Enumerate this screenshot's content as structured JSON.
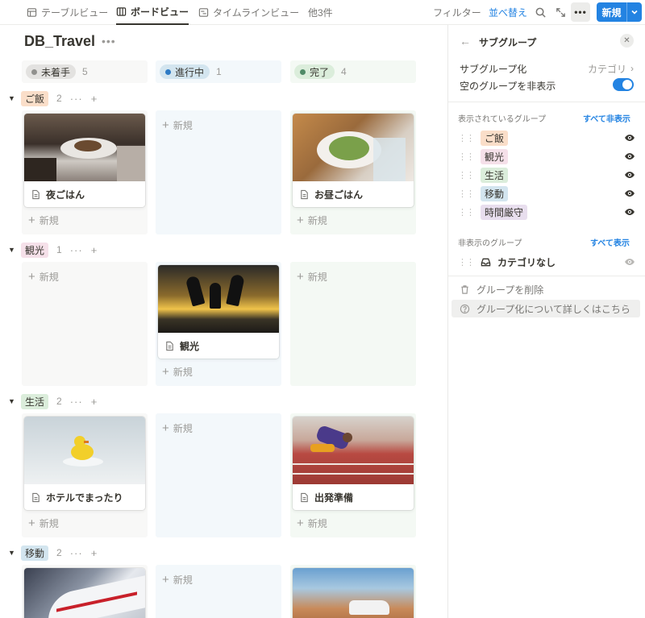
{
  "tabs": [
    {
      "label": "テーブルビュー",
      "icon": "table-icon",
      "active": false
    },
    {
      "label": "ボードビュー",
      "icon": "board-icon",
      "active": true
    },
    {
      "label": "タイムラインビュー",
      "icon": "timeline-icon",
      "active": false
    },
    {
      "label": "他3件",
      "icon": "",
      "active": false
    }
  ],
  "toolbar": {
    "filter_label": "フィルター",
    "sort_label": "並べ替え",
    "more_label": "•••",
    "new_label": "新規"
  },
  "board": {
    "title": "DB_Travel",
    "title_more": "•••",
    "columns": [
      {
        "label": "未着手",
        "count": "5",
        "dot": "#91918e",
        "pill": "#e3e2e0",
        "bg": "#f8f8f7"
      },
      {
        "label": "進行中",
        "count": "1",
        "dot": "#2e7bc5",
        "pill": "#d3e5ef",
        "bg": "#f3f8fb"
      },
      {
        "label": "完了",
        "count": "4",
        "dot": "#4f8a67",
        "pill": "#dbeddb",
        "bg": "#f4f9f4"
      }
    ],
    "new_label": "新規",
    "groups": [
      {
        "tag": "ご飯",
        "count": "2",
        "color": "#fadec9",
        "cards": [
          "夜ごはん",
          "",
          "お昼ごはん"
        ]
      },
      {
        "tag": "観光",
        "count": "1",
        "color": "#f5e0e9",
        "cards": [
          "",
          "観光",
          ""
        ]
      },
      {
        "tag": "生活",
        "count": "2",
        "color": "#dbeddb",
        "cards": [
          "ホテルでまったり",
          "",
          "出発準備"
        ]
      },
      {
        "tag": "移動",
        "count": "2",
        "color": "#d3e5ef",
        "cards": [
          "",
          "",
          ""
        ]
      }
    ]
  },
  "panel": {
    "title": "サブグループ",
    "subgroup_label": "サブグループ化",
    "subgroup_value": "カテゴリ",
    "hide_empty_label": "空のグループを非表示",
    "hide_empty_on": true,
    "visible_section": "表示されているグループ",
    "hide_all": "すべて非表示",
    "visible_groups": [
      {
        "label": "ご飯",
        "color": "#fadec9"
      },
      {
        "label": "観光",
        "color": "#f5e0e9"
      },
      {
        "label": "生活",
        "color": "#dbeddb"
      },
      {
        "label": "移動",
        "color": "#d3e5ef"
      },
      {
        "label": "時間厳守",
        "color": "#e8deee"
      }
    ],
    "hidden_section": "非表示のグループ",
    "show_all": "すべて表示",
    "hidden_groups": [
      {
        "label": "カテゴリなし"
      }
    ],
    "delete_label": "グループを削除",
    "help_label": "グループ化について詳しくはこちら"
  },
  "colors": {
    "accent": "#2383e2"
  }
}
